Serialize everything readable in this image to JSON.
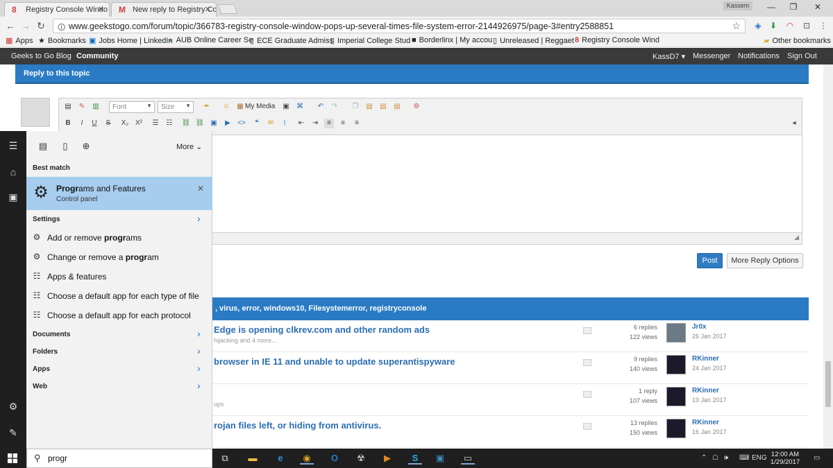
{
  "browser": {
    "tabs": [
      {
        "label": "Registry Console Windo",
        "icon": "8",
        "icon_color": "#d23c3c"
      },
      {
        "label": "New reply to Registry Co",
        "icon": "M",
        "icon_color": "#d23c3c"
      }
    ],
    "user_badge": "Kassem",
    "url": "www.geekstogo.com/forum/topic/366783-registry-console-window-pops-up-several-times-file-system-error-2144926975/page-3#entry2588851",
    "bookmarks": [
      {
        "label": "Apps",
        "icon": "apps-icon"
      },
      {
        "label": "Bookmarks",
        "icon": "star-icon"
      },
      {
        "label": "Jobs Home | LinkedIn",
        "icon": "linkedin-icon"
      },
      {
        "label": "AUB Online Career Se",
        "icon": "aub-icon"
      },
      {
        "label": "ECE Graduate Admiss",
        "icon": "page-icon"
      },
      {
        "label": "Imperial College Stud",
        "icon": "page-icon"
      },
      {
        "label": "Borderlinx | My accou",
        "icon": "borderlinx-icon"
      },
      {
        "label": "Unreleased | Reggaet",
        "icon": "page-icon"
      },
      {
        "label": "Registry Console Wind",
        "icon": "g2g-icon"
      }
    ],
    "other_bookmarks": "Other bookmarks"
  },
  "site": {
    "nav_left": [
      "Geeks to Go Blog",
      "Community"
    ],
    "user_menu": "KassD7 ▾",
    "nav_right": [
      "Messenger",
      "Notifications",
      "Sign Out"
    ],
    "reply_title": "Reply to this topic",
    "editor": {
      "font_placeholder": "Font",
      "size_placeholder": "Size",
      "my_media": "My Media"
    },
    "post_button": "Post",
    "more_reply_button": "More Reply Options",
    "tags_text": ", virus, error, windows10, Filesystemerror, registryconsole",
    "topics": [
      {
        "title": "Edge is opening clkrev.com and other random ads",
        "sub": "hijacking and 4 more...",
        "replies": "6 replies",
        "views": "122 views",
        "user": "Jr0x",
        "date": "26 Jan 2017"
      },
      {
        "title": "browser in IE 11 and unable to update superantispyware",
        "sub": "",
        "replies": "9 replies",
        "views": "140 views",
        "user": "RKinner",
        "date": "24 Jan 2017"
      },
      {
        "title": "",
        "sub": "ups",
        "replies": "1 reply",
        "views": "107 views",
        "user": "RKinner",
        "date": "19 Jan 2017"
      },
      {
        "title": "rojan files left, or hiding from antivirus.",
        "sub": "",
        "replies": "13 replies",
        "views": "150 views",
        "user": "RKinner",
        "date": "16 Jan 2017"
      }
    ]
  },
  "start_menu": {
    "more": "More",
    "best_match_heading": "Best match",
    "best_match": {
      "title_bold": "Progr",
      "title_rest": "ams and Features",
      "subtitle": "Control panel"
    },
    "settings_heading": "Settings",
    "settings_items": [
      {
        "pre": "Add or remove ",
        "bold": "progr",
        "post": "ams",
        "icon": "gear-icon"
      },
      {
        "pre": "Change or remove a ",
        "bold": "progr",
        "post": "am",
        "icon": "gear-icon"
      },
      {
        "pre": "Apps & features",
        "bold": "",
        "post": "",
        "icon": "list-icon"
      },
      {
        "pre": "Choose a default app for each type of file",
        "bold": "",
        "post": "",
        "icon": "list-icon"
      },
      {
        "pre": "Choose a default app for each protocol",
        "bold": "",
        "post": "",
        "icon": "list-icon"
      }
    ],
    "categories": [
      "Documents",
      "Folders",
      "Apps",
      "Web"
    ],
    "search_query": "progr"
  },
  "taskbar": {
    "language": "ENG",
    "time": "12:00 AM",
    "date": "1/29/2017"
  }
}
